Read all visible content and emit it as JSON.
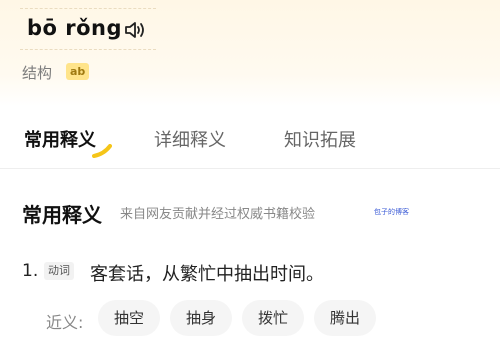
{
  "word": {
    "pinyin": "bō  rǒng",
    "structure_label": "结构",
    "structure_value": "ab"
  },
  "tabs": [
    {
      "label": "常用释义",
      "active": true
    },
    {
      "label": "详细释义",
      "active": false
    },
    {
      "label": "知识拓展",
      "active": false
    }
  ],
  "section": {
    "title": "常用释义",
    "source": "来自网友贡献并经过权威书籍校验"
  },
  "watermark": "包子的博客",
  "definition": {
    "number": "1.",
    "pos": "动词",
    "text": "客套话，从繁忙中抽出时间。"
  },
  "synonyms": {
    "label": "近义:",
    "items": [
      "抽空",
      "抽身",
      "拨忙",
      "腾出"
    ]
  },
  "colors": {
    "accent": "#f5c518",
    "header_bg": "#fff7e6"
  },
  "icons": [
    "speaker-icon"
  ]
}
